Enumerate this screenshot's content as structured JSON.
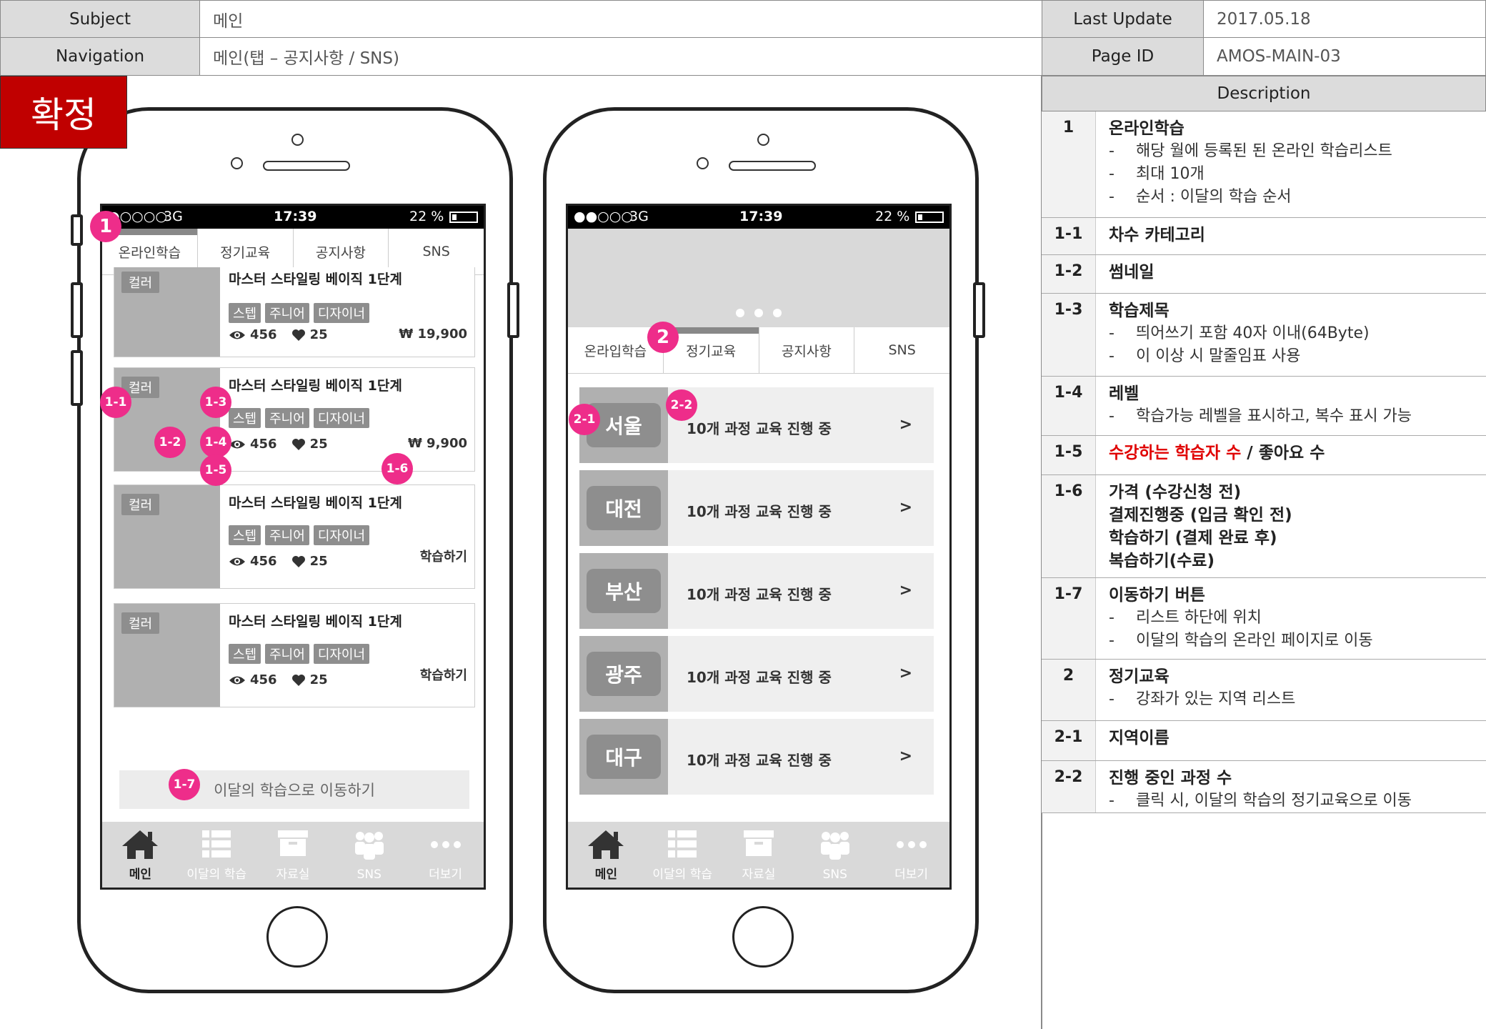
{
  "header": {
    "subject_label": "Subject",
    "subject_value": "메인",
    "navigation_label": "Navigation",
    "navigation_value": "메인(탭 – 공지사항 / SNS)",
    "last_update_label": "Last Update",
    "last_update_value": "2017.05.18",
    "page_id_label": "Page ID",
    "page_id_value": "AMOS-MAIN-03"
  },
  "stamp": "확정",
  "phone1": {
    "status": {
      "signal": "●○○○○",
      "network": "3G",
      "time": "17:39",
      "battery": "22 %"
    },
    "tabs": [
      "온라인학습",
      "정기교육",
      "공지사항",
      "SNS"
    ],
    "cards": [
      {
        "category": "컬러",
        "title": "마스터 스타일링 베이직 1단계",
        "levels": [
          "스텝",
          "주니어",
          "디자이너"
        ],
        "views": "456",
        "likes": "25",
        "price": "₩ 19,900"
      },
      {
        "category": "컬러",
        "title": "마스터 스타일링 베이직 1단계",
        "levels": [
          "스텝",
          "주니어",
          "디자이너"
        ],
        "views": "456",
        "likes": "25",
        "price": "₩ 9,900"
      },
      {
        "category": "컬러",
        "title": "마스터 스타일링 베이직 1단계",
        "levels": [
          "스텝",
          "주니어",
          "디자이너"
        ],
        "views": "456",
        "likes": "25",
        "price": "학습하기"
      },
      {
        "category": "컬러",
        "title": "마스터 스타일링 베이직 1단계",
        "levels": [
          "스텝",
          "주니어",
          "디자이너"
        ],
        "views": "456",
        "likes": "25",
        "price": "학습하기"
      }
    ],
    "move_button": "이달의 학습으로 이동하기"
  },
  "phone2": {
    "status": {
      "signal": "●●○○○",
      "network": "3G",
      "time": "17:39",
      "battery": "22 %"
    },
    "tabs": [
      "온라입학습",
      "정기교육",
      "공지사항",
      "SNS"
    ],
    "regions": [
      {
        "name": "서울",
        "text": "10개 과정 교육 진행 중",
        "arrow": ">"
      },
      {
        "name": "대전",
        "text": "10개 과정 교육 진행 중",
        "arrow": ">"
      },
      {
        "name": "부산",
        "text": "10개 과정 교육 진행 중",
        "arrow": ">"
      },
      {
        "name": "광주",
        "text": "10개 과정 교육 진행 중",
        "arrow": ">"
      },
      {
        "name": "대구",
        "text": "10개 과정 교육 진행 중",
        "arrow": ">"
      }
    ]
  },
  "bottom_nav": [
    "메인",
    "이달의 학습",
    "자료실",
    "SNS",
    "더보기"
  ],
  "markers": {
    "m1": "1",
    "m11": "1-1",
    "m12": "1-2",
    "m13": "1-3",
    "m14": "1-4",
    "m15": "1-5",
    "m16": "1-6",
    "m17": "1-7",
    "m2": "2",
    "m21": "2-1",
    "m22": "2-2"
  },
  "description": {
    "heading": "Description",
    "rows": [
      {
        "num": "1",
        "title": "온라인학습",
        "subs": [
          "해당 월에 등록된 된 온라인 학습리스트",
          "최대 10개",
          "순서 : 이달의 학습 순서"
        ]
      },
      {
        "num": "1-1",
        "title": "차수 카테고리",
        "subs": []
      },
      {
        "num": "1-2",
        "title": "썸네일",
        "subs": []
      },
      {
        "num": "1-3",
        "title": "학습제목",
        "subs": [
          "띄어쓰기 포함 40자 이내(64Byte)",
          "이 이상 시 말줄임표 사용"
        ]
      },
      {
        "num": "1-4",
        "title": "레벨",
        "subs": [
          "학습가능 레벨을 표시하고, 복수 표시 가능"
        ]
      },
      {
        "num": "1-5",
        "title_red": "수강하는 학습자 수",
        "title_rest": " / 좋아요 수",
        "subs": []
      },
      {
        "num": "1-6",
        "lines": [
          "가격 (수강신청 전)",
          "결제진행중 (입금 확인 전)",
          "학습하기 (결제 완료 후)",
          "복습하기(수료)"
        ],
        "subs": []
      },
      {
        "num": "1-7",
        "title": "이동하기 버튼",
        "subs": [
          "리스트 하단에 위치",
          "이달의 학습의 온라인 페이지로 이동"
        ]
      },
      {
        "num": "2",
        "title": "정기교육",
        "subs": [
          "강좌가 있는 지역 리스트"
        ]
      },
      {
        "num": "2-1",
        "title": "지역이름",
        "subs": []
      },
      {
        "num": "2-2",
        "title": "진행 중인 과정 수",
        "subs": [
          "클릭 시, 이달의 학습의 정기교육으로 이동"
        ]
      }
    ]
  }
}
